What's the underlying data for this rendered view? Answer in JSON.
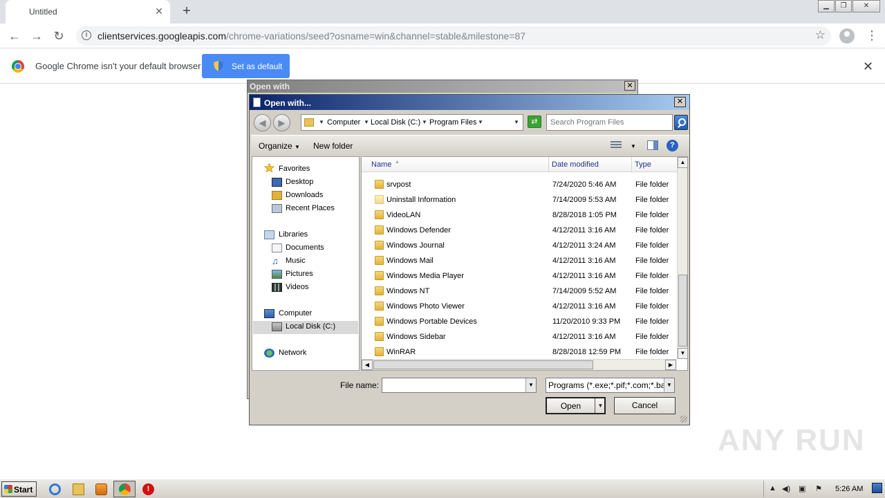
{
  "browser": {
    "tab_title": "Untitled",
    "tab_close": "✕",
    "new_tab": "+",
    "url_host": "clientservices.googleapis.com",
    "url_path": "/chrome-variations/seed?osname=win&channel=stable&milestone=87"
  },
  "infobar": {
    "message": "Google Chrome isn't your default browser",
    "button_label": "Set as default",
    "close": "✕"
  },
  "outer_dialog": {
    "title": "Open with",
    "close": "✕"
  },
  "dialog": {
    "title": "Open with...",
    "close": "✕",
    "breadcrumb": [
      "Computer",
      "Local Disk (C:)",
      "Program Files"
    ],
    "search_placeholder": "Search Program Files",
    "organize": "Organize",
    "new_folder": "New folder",
    "help": "?",
    "nav": {
      "favorites": "Favorites",
      "desktop": "Desktop",
      "downloads": "Downloads",
      "recent": "Recent Places",
      "libraries": "Libraries",
      "documents": "Documents",
      "music": "Music",
      "pictures": "Pictures",
      "videos": "Videos",
      "computer": "Computer",
      "local_disk": "Local Disk (C:)",
      "network": "Network"
    },
    "columns": {
      "name": "Name",
      "date": "Date modified",
      "type": "Type"
    },
    "files": [
      {
        "name": "srvpost",
        "date": "7/24/2020 5:46 AM",
        "type": "File folder"
      },
      {
        "name": "Uninstall Information",
        "date": "7/14/2009 5:53 AM",
        "type": "File folder"
      },
      {
        "name": "VideoLAN",
        "date": "8/28/2018 1:05 PM",
        "type": "File folder"
      },
      {
        "name": "Windows Defender",
        "date": "4/12/2011 3:16 AM",
        "type": "File folder"
      },
      {
        "name": "Windows Journal",
        "date": "4/12/2011 3:24 AM",
        "type": "File folder"
      },
      {
        "name": "Windows Mail",
        "date": "4/12/2011 3:16 AM",
        "type": "File folder"
      },
      {
        "name": "Windows Media Player",
        "date": "4/12/2011 3:16 AM",
        "type": "File folder"
      },
      {
        "name": "Windows NT",
        "date": "7/14/2009 5:52 AM",
        "type": "File folder"
      },
      {
        "name": "Windows Photo Viewer",
        "date": "4/12/2011 3:16 AM",
        "type": "File folder"
      },
      {
        "name": "Windows Portable Devices",
        "date": "11/20/2010 9:33 PM",
        "type": "File folder"
      },
      {
        "name": "Windows Sidebar",
        "date": "4/12/2011 3:16 AM",
        "type": "File folder"
      },
      {
        "name": "WinRAR",
        "date": "8/28/2018 12:59 PM",
        "type": "File folder"
      }
    ],
    "file_name_label": "File name:",
    "file_name_value": "",
    "filter_value": "Programs (*.exe;*.pif;*.com;*.bat;*.cmd)",
    "open_label": "Open",
    "cancel_label": "Cancel"
  },
  "taskbar": {
    "start": "Start",
    "clock": "5:26 AM"
  },
  "watermark": "ANY RUN"
}
